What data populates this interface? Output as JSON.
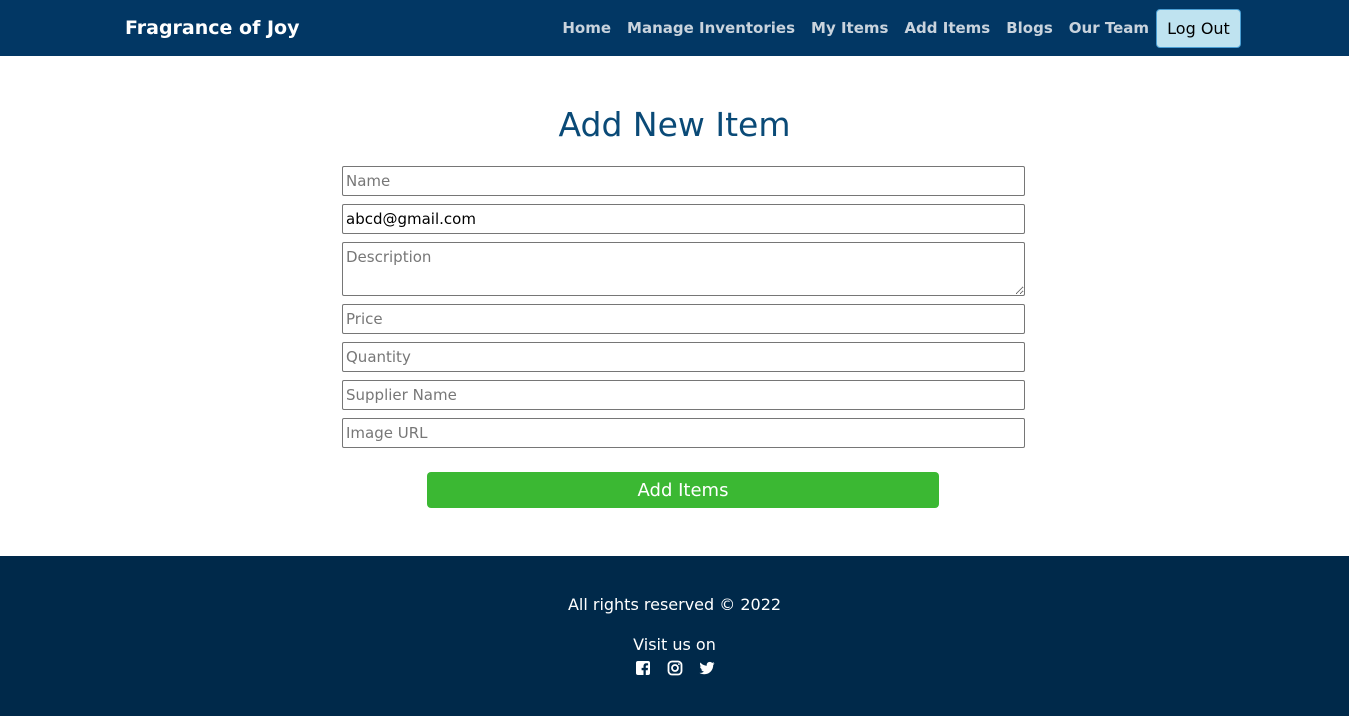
{
  "nav": {
    "brand": "Fragrance of Joy",
    "links": [
      "Home",
      "Manage Inventories",
      "My Items",
      "Add Items",
      "Blogs",
      "Our Team"
    ],
    "logout_label": "Log Out"
  },
  "form": {
    "title": "Add New Item",
    "name_placeholder": "Name",
    "email_value": "abcd@gmail.com",
    "description_placeholder": "Description",
    "price_placeholder": "Price",
    "quantity_placeholder": "Quantity",
    "supplier_placeholder": "Supplier Name",
    "image_placeholder": "Image URL",
    "submit_label": "Add Items"
  },
  "footer": {
    "rights": "All rights reserved © 2022",
    "visit": "Visit us on",
    "social_icons": [
      "facebook-icon",
      "instagram-icon",
      "twitter-icon"
    ]
  },
  "colors": {
    "navbar": "#023764",
    "footer": "#00294a",
    "title": "#0a4a77",
    "submit": "#3bb833",
    "logout_bg": "#bfe3f0"
  }
}
